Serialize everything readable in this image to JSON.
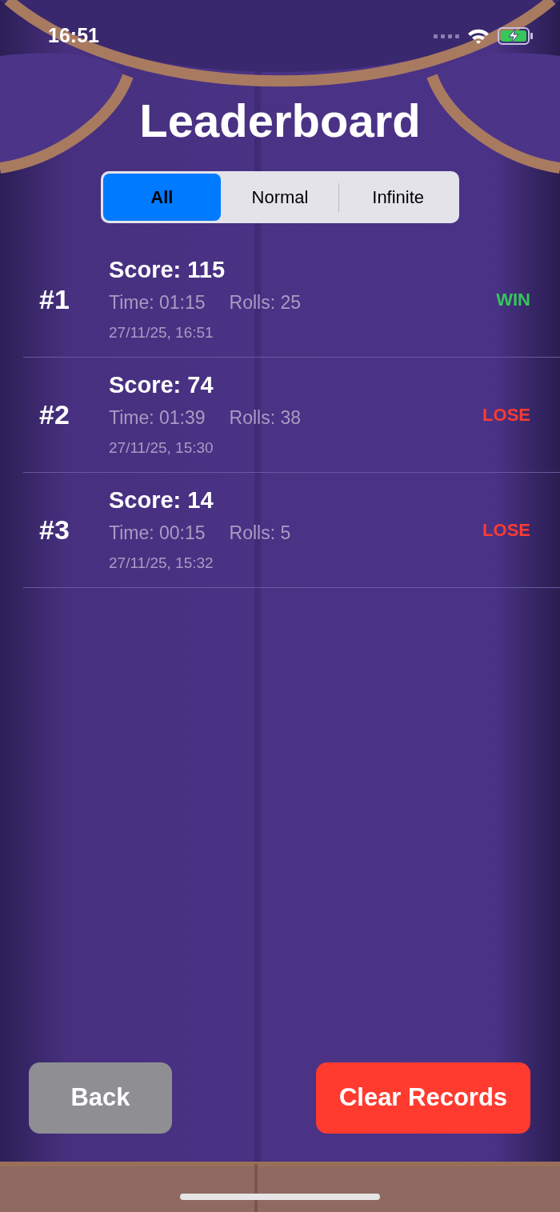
{
  "status_bar": {
    "time": "16:51"
  },
  "title": "Leaderboard",
  "tabs": [
    {
      "label": "All",
      "selected": true
    },
    {
      "label": "Normal",
      "selected": false
    },
    {
      "label": "Infinite",
      "selected": false
    }
  ],
  "records": [
    {
      "rank": "#1",
      "score": "Score: 115",
      "time": "Time: 01:15",
      "rolls": "Rolls: 25",
      "date": "27/11/25, 16:51",
      "result": "WIN",
      "kind": "win"
    },
    {
      "rank": "#2",
      "score": "Score: 74",
      "time": "Time: 01:39",
      "rolls": "Rolls: 38",
      "date": "27/11/25, 15:30",
      "result": "LOSE",
      "kind": "lose"
    },
    {
      "rank": "#3",
      "score": "Score: 14",
      "time": "Time: 00:15",
      "rolls": "Rolls: 5",
      "date": "27/11/25, 15:32",
      "result": "LOSE",
      "kind": "lose"
    }
  ],
  "buttons": {
    "back": "Back",
    "clear": "Clear Records"
  }
}
